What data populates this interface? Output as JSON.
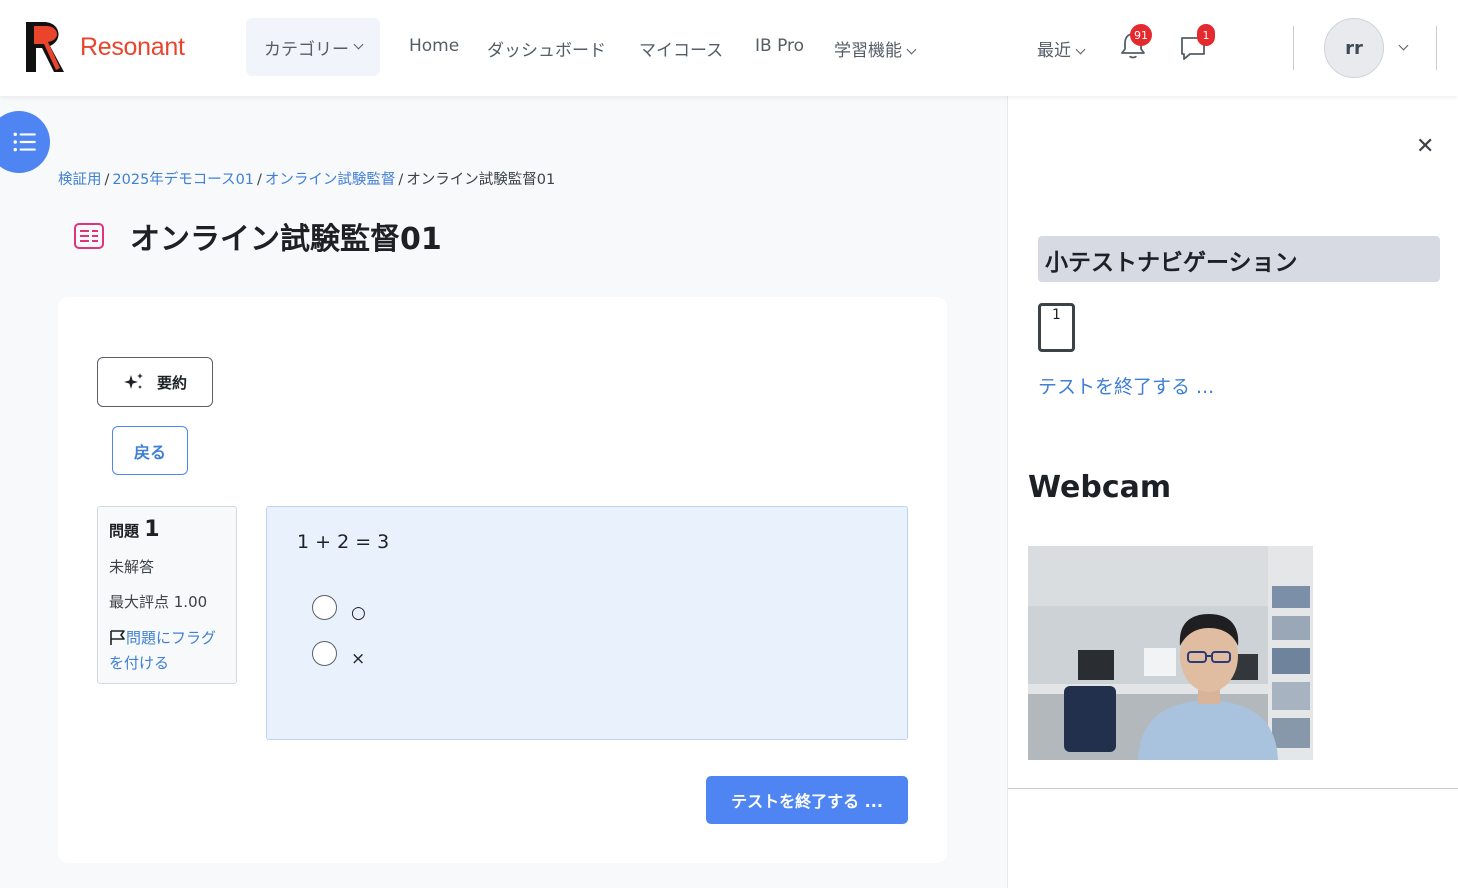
{
  "brand": {
    "name": "Resonant",
    "color": "#e8452c"
  },
  "nav": {
    "category": "カテゴリー",
    "links": [
      "Home",
      "ダッシュボード",
      "マイコース",
      "IB Pro"
    ],
    "learning": "学習機能",
    "recent": "最近",
    "notifications_count": "91",
    "messages_count": "1",
    "user_initials": "rr"
  },
  "breadcrumb": {
    "items": [
      "検証用",
      "2025年デモコース01",
      "オンライン試験監督"
    ],
    "current": "オンライン試験監督01"
  },
  "page": {
    "title": "オンライン試験監督01"
  },
  "actions": {
    "summary": "要約",
    "back": "戻る",
    "finish": "テストを終了する ..."
  },
  "question": {
    "label": "問題",
    "number": "1",
    "status": "未解答",
    "max_score": "最大評点 1.00",
    "flag": "問題にフラグを付ける",
    "text": "1 + 2 = 3",
    "options": [
      "○",
      "×"
    ]
  },
  "drawer": {
    "nav_title": "小テストナビゲーション",
    "nav_button": "1",
    "finish_link": "テストを終了する ...",
    "webcam_title": "Webcam"
  },
  "colors": {
    "accent": "#4e85f2",
    "link": "#3f7fd6",
    "badge": "#e4292f",
    "title_icon": "#e0337a"
  }
}
